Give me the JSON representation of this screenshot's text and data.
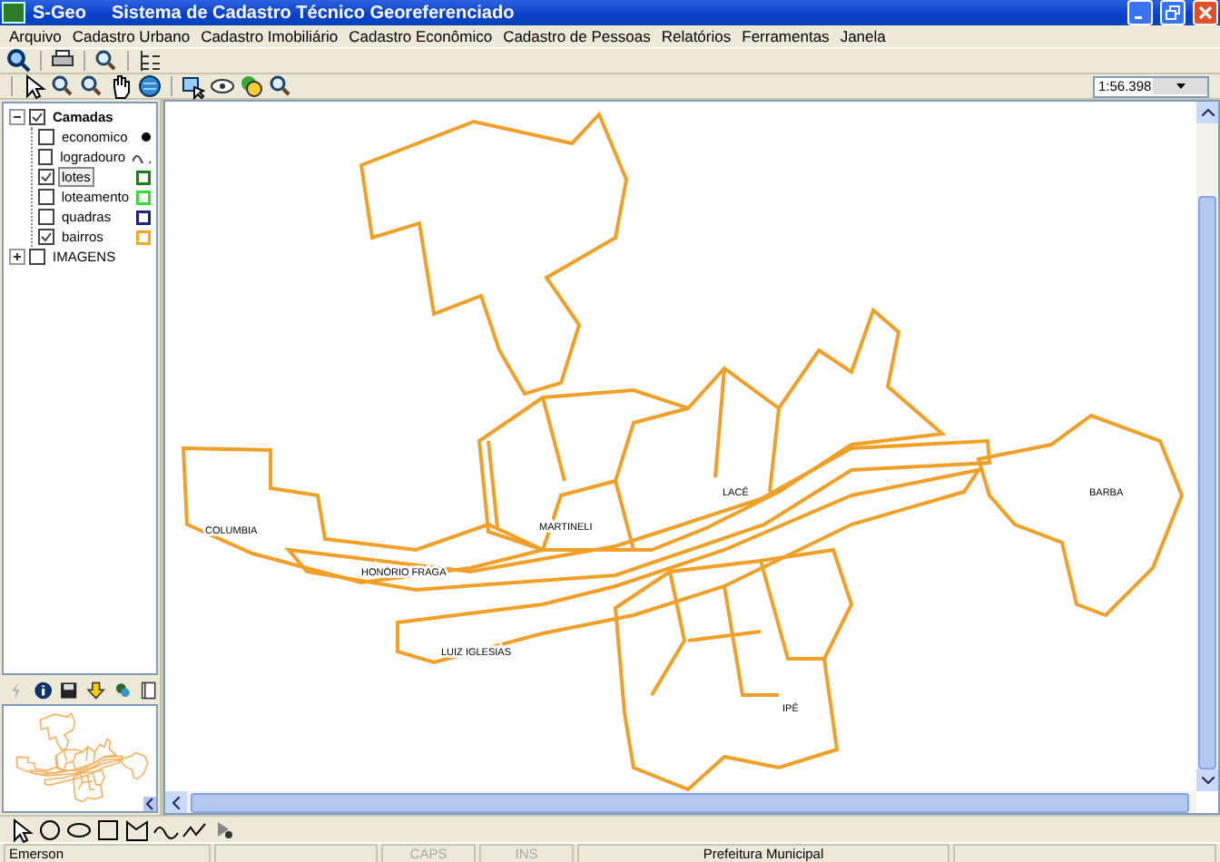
{
  "window": {
    "app": "S-Geo",
    "title": "Sistema de Cadastro Técnico Georeferenciado"
  },
  "menu": [
    "Arquivo",
    "Cadastro Urbano",
    "Cadastro Imobiliário",
    "Cadastro Econômico",
    "Cadastro de Pessoas",
    "Relatórios",
    "Ferramentas",
    "Janela"
  ],
  "scale": {
    "value": "1:56.398"
  },
  "layers": {
    "label": "Camadas",
    "checked": true,
    "expanded": true,
    "children": [
      {
        "label": "economico",
        "checked": false,
        "selected": false,
        "kind": "point",
        "color": "#000000"
      },
      {
        "label": "logradouro",
        "checked": false,
        "selected": false,
        "kind": "line",
        "color": "#404040"
      },
      {
        "label": "lotes",
        "checked": true,
        "selected": true,
        "kind": "polygon",
        "color": "#1e7a1e"
      },
      {
        "label": "loteamento",
        "checked": false,
        "selected": false,
        "kind": "polygon",
        "color": "#33dd33"
      },
      {
        "label": "quadras",
        "checked": false,
        "selected": false,
        "kind": "polygon",
        "color": "#202080"
      },
      {
        "label": "bairros",
        "checked": true,
        "selected": false,
        "kind": "polygon",
        "color": "#f5a623"
      }
    ]
  },
  "images_group": {
    "label": "IMAGENS",
    "checked": false,
    "expanded": false
  },
  "map": {
    "labels": [
      "COLUMBIA",
      "HONÓRIO FRAGA",
      "MARTINELI",
      "LACÊ",
      "BARBA",
      "LUIZ IGLESIAS",
      "IPÊ"
    ]
  },
  "status_bar": [
    {
      "text": "Emerson",
      "disabled": false
    },
    {
      "text": "CAPS",
      "disabled": true
    },
    {
      "text": "INS",
      "disabled": true
    },
    {
      "text": "Prefeitura Municipal",
      "disabled": false
    }
  ]
}
